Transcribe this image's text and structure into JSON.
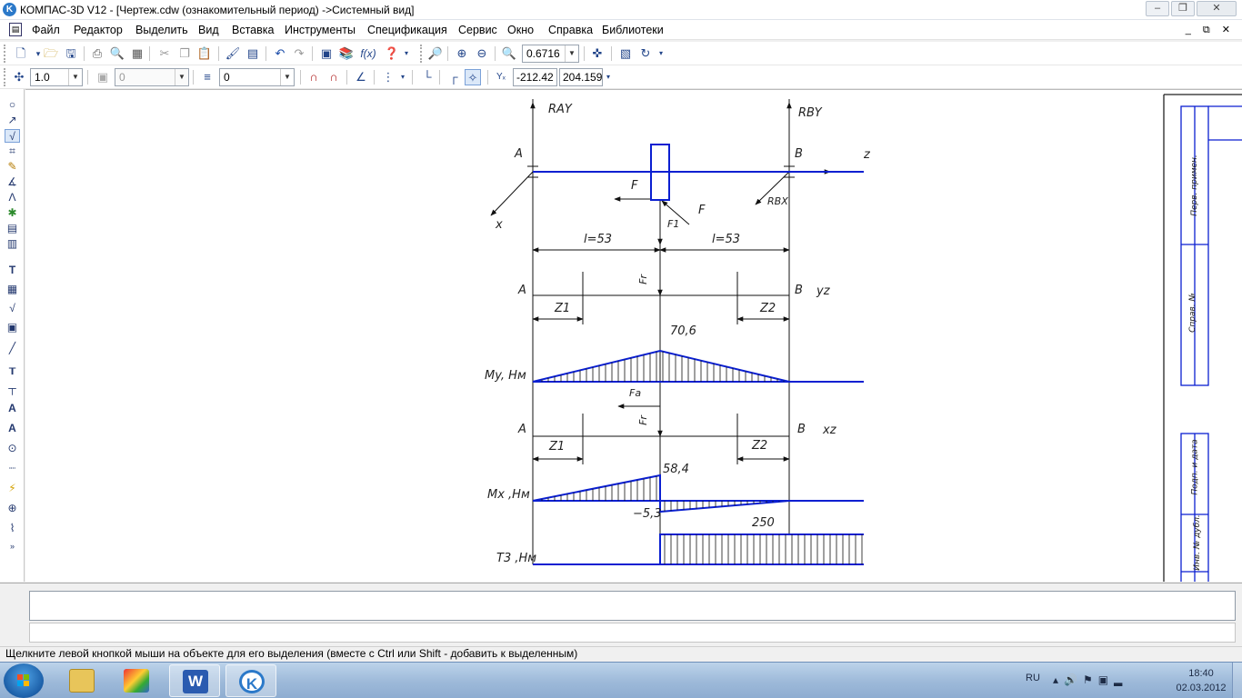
{
  "window": {
    "title": "КОМПАС-3D V12 - [Чертеж.cdw (ознакомительный период) ->Системный вид]",
    "app_icon_letter": "K",
    "buttons": [
      "minimize",
      "maximize",
      "close"
    ]
  },
  "menu": {
    "items": [
      "Файл",
      "Редактор",
      "Выделить",
      "Вид",
      "Вставка",
      "Инструменты",
      "Спецификация",
      "Сервис",
      "Окно",
      "Справка",
      "Библиотеки"
    ],
    "mdi_buttons": "_ ⧉ ✕"
  },
  "toolbar1": {
    "zoom_value": "0.6716"
  },
  "toolbar2": {
    "line_scale": "1.0",
    "layer_value": "0",
    "style_value": "0",
    "coord_x": "-212.42",
    "coord_y": "204.159"
  },
  "drawing": {
    "labels": {
      "RAY": "RAY",
      "RBY": "RBY",
      "A_top": "A",
      "B_top": "B",
      "z_axis": "z",
      "x_axis": "x",
      "F_left": "F",
      "F_diag": "F",
      "F1_top": "F1",
      "RBX": "RBX",
      "l_left": "l=53",
      "l_right": "l=53",
      "Fr_vert1": "Fr",
      "A_yz": "A",
      "B_yz": "B",
      "yz": "yz",
      "Z1_a": "Z1",
      "Z2_a": "Z2",
      "val_706": "70,6",
      "My_label": "My, Hм",
      "Fa_label": "Fa",
      "Fr_vert2": "Fr",
      "A_xz": "A",
      "B_xz": "B",
      "xz": "xz",
      "Z1_b": "Z1",
      "Z2_b": "Z2",
      "val_584": "58,4",
      "Mx_label": "Mx ,Hм",
      "val_m53": "−5,3",
      "val_250": "250",
      "T_label": "T3 ,Hм"
    },
    "title_block": [
      "Перв. примен.",
      "Справ. №",
      "Подп. и дата",
      "Инв. № дубл."
    ]
  },
  "status": {
    "message": "Щелкните левой кнопкой мыши на объекте для его выделения (вместе с Ctrl или Shift - добавить к выделенным)"
  },
  "taskbar": {
    "apps": [
      "explorer",
      "paint-app",
      "word",
      "kompas"
    ],
    "word_letter": "W",
    "kompas_letter": "K",
    "lang": "RU",
    "time": "18:40",
    "date": "02.03.2012"
  },
  "colors": {
    "drawing_blue": "#0a1fd1",
    "drawing_black": "#111111",
    "taskbar": "#9db9d9"
  }
}
